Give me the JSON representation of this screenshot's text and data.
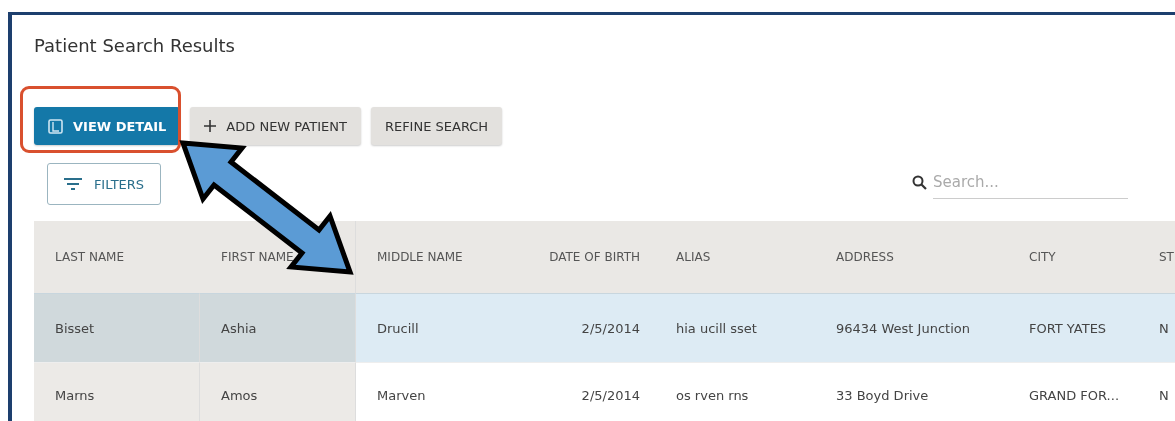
{
  "title": "Patient Search Results",
  "toolbar": [
    {
      "label": "VIEW DETAIL",
      "kind": "primary"
    },
    {
      "label": "ADD NEW PATIENT",
      "kind": "add"
    },
    {
      "label": "REFINE SEARCH",
      "kind": "secondary"
    }
  ],
  "filters_button": {
    "label": "FILTERS"
  },
  "search": {
    "placeholder": "Search..."
  },
  "table": {
    "columns": [
      "LAST NAME",
      "FIRST NAME",
      "MIDDLE NAME",
      "DATE OF BIRTH",
      "ALIAS",
      "ADDRESS",
      "CITY",
      "ST"
    ],
    "rows": [
      {
        "selected": true,
        "cells": [
          "Bisset",
          "Ashia",
          "Drucill",
          "2/5/2014",
          "hia ucill sset",
          "96434 West Junction",
          "FORT YATES",
          "N"
        ]
      },
      {
        "selected": false,
        "cells": [
          "Marns",
          "Amos",
          "Marven",
          "2/5/2014",
          "os rven rns",
          "33 Boyd Drive",
          "GRAND FOR...",
          "N"
        ]
      }
    ]
  }
}
